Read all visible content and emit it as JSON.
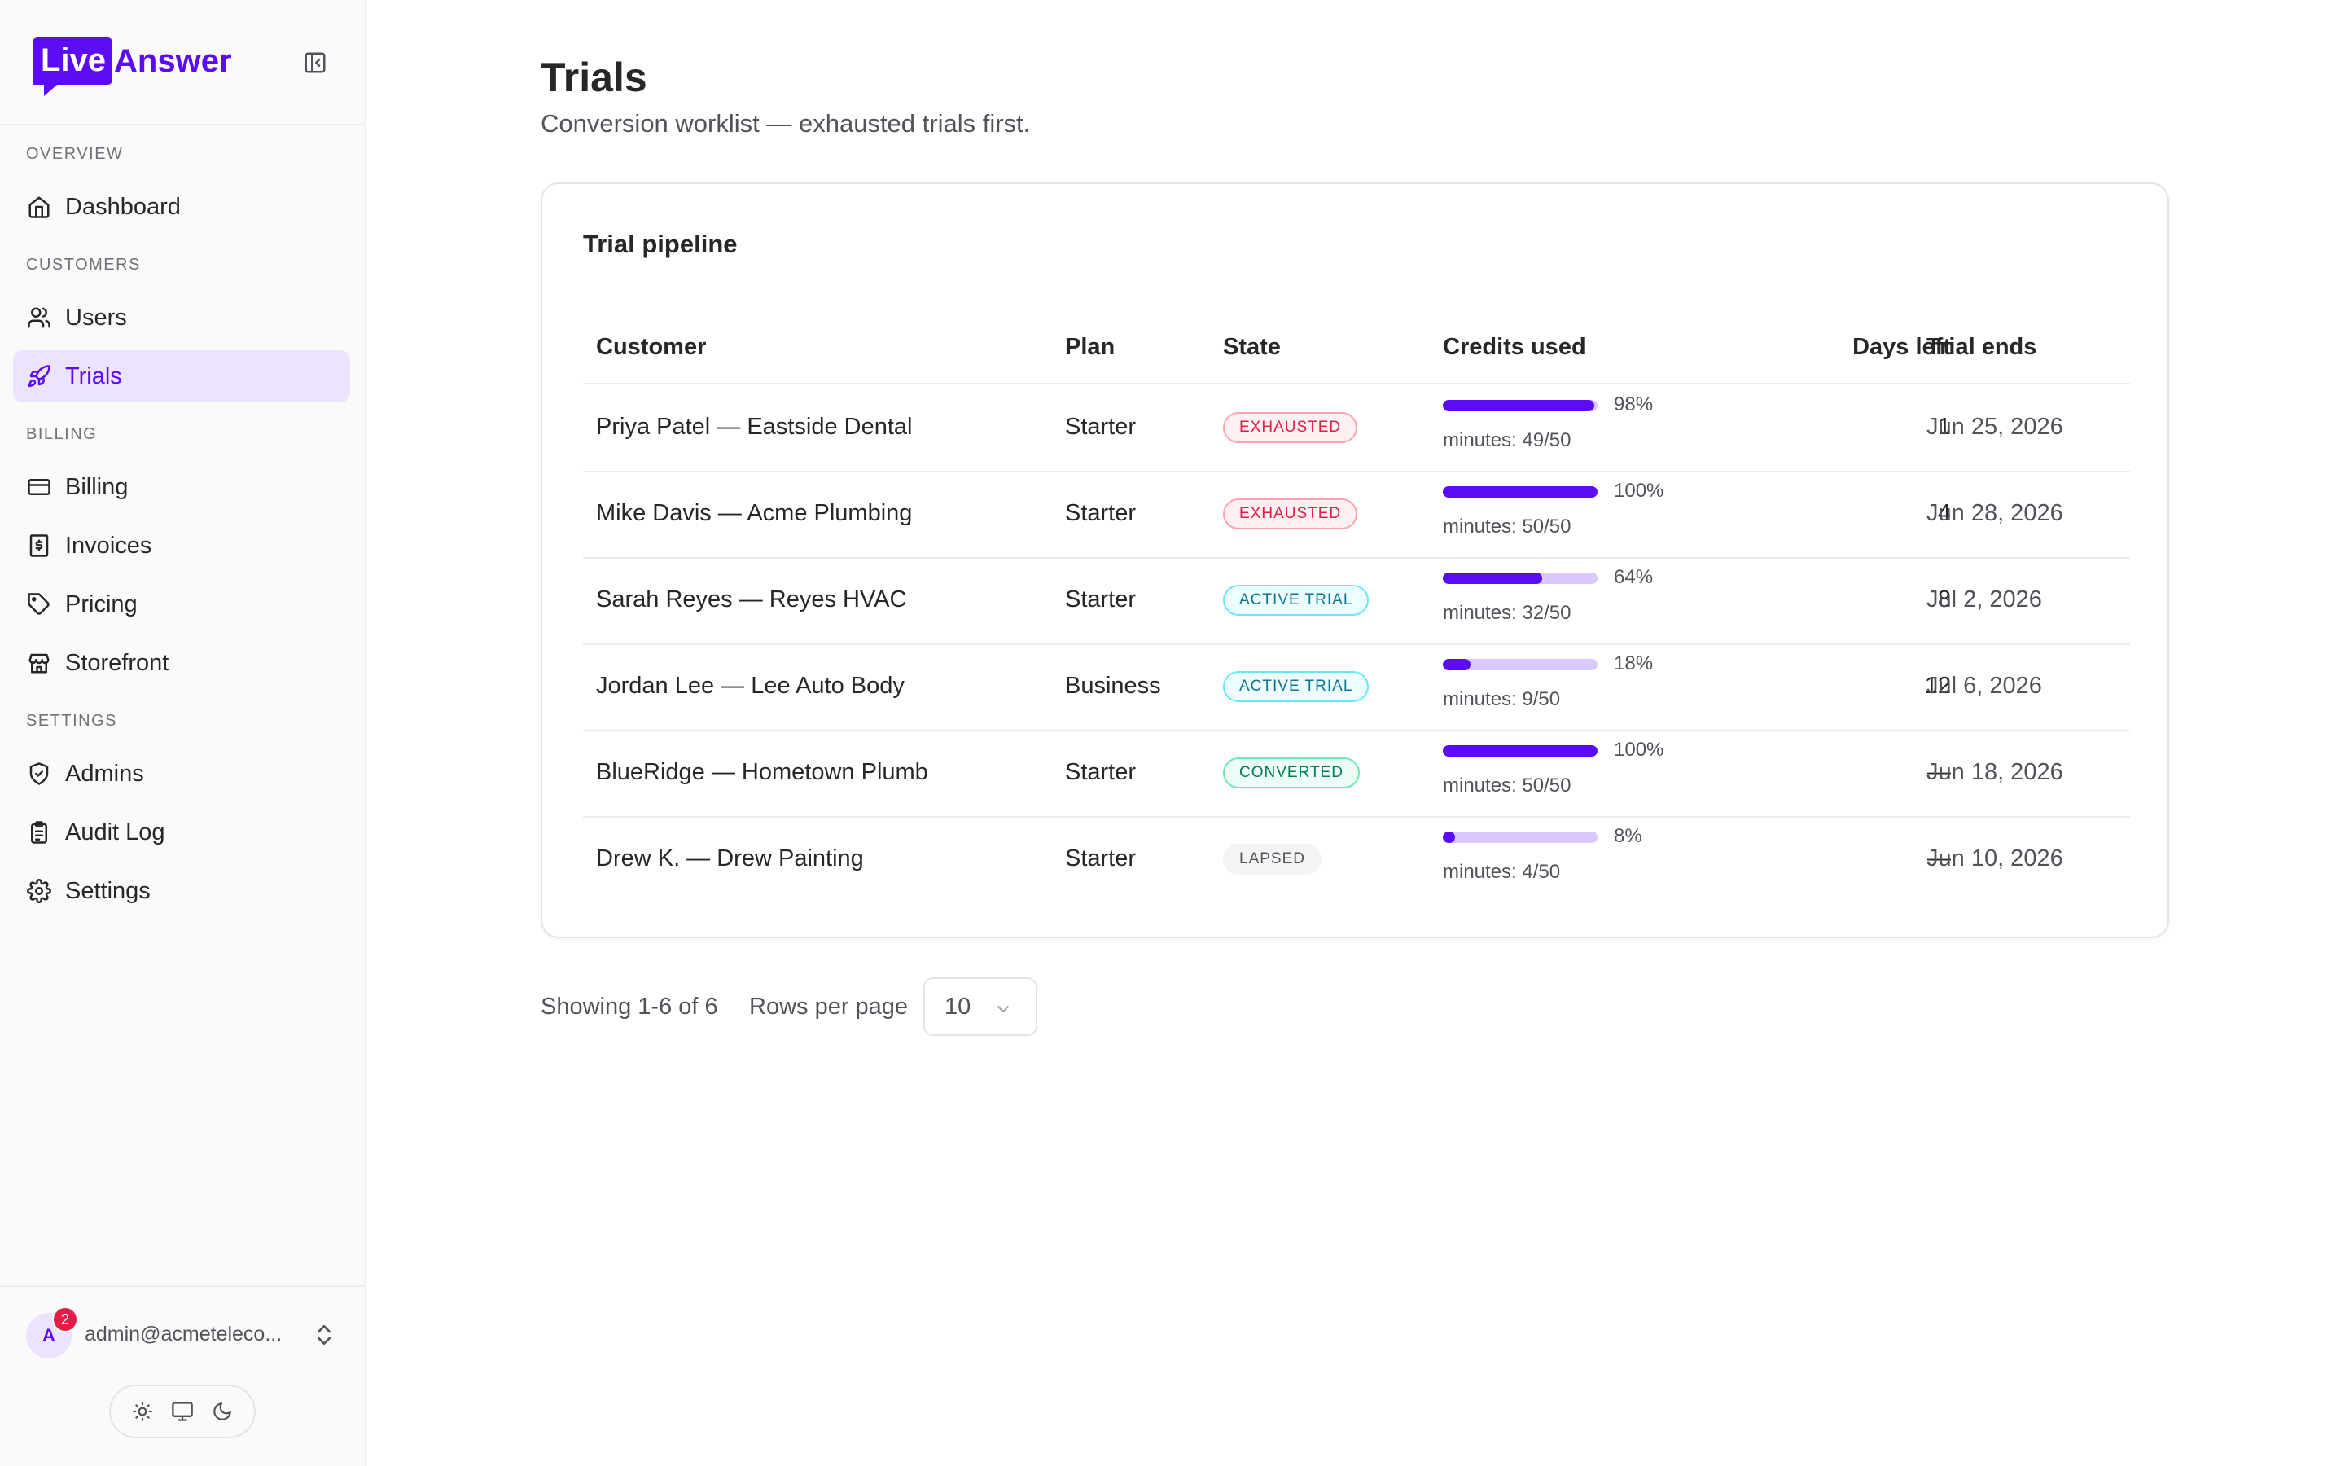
{
  "brand": {
    "logo_box": "Live",
    "logo_word": "Answer",
    "accent": "#5b0cf2"
  },
  "sidebar": {
    "sections": [
      {
        "label": "OVERVIEW"
      },
      {
        "label": "CUSTOMERS"
      },
      {
        "label": "BILLING"
      },
      {
        "label": "SETTINGS"
      }
    ],
    "items": [
      {
        "label": "Dashboard",
        "icon": "home-icon"
      },
      {
        "label": "Users",
        "icon": "users-icon"
      },
      {
        "label": "Trials",
        "icon": "rocket-icon",
        "active": true
      },
      {
        "label": "Billing",
        "icon": "credit-card-icon"
      },
      {
        "label": "Invoices",
        "icon": "receipt-icon"
      },
      {
        "label": "Pricing",
        "icon": "tag-icon"
      },
      {
        "label": "Storefront",
        "icon": "store-icon"
      },
      {
        "label": "Admins",
        "icon": "shield-icon"
      },
      {
        "label": "Audit Log",
        "icon": "clipboard-icon"
      },
      {
        "label": "Settings",
        "icon": "gear-icon"
      }
    ],
    "user": {
      "avatar_letter": "A",
      "notifications": "2",
      "email": "admin@acmeteleco..."
    }
  },
  "page": {
    "title": "Trials",
    "subtitle": "Conversion worklist — exhausted trials first."
  },
  "card": {
    "title": "Trial pipeline",
    "columns": [
      "Customer",
      "Plan",
      "State",
      "Credits used",
      "Days left",
      "Trial ends"
    ],
    "rows": [
      {
        "customer": "Priya Patel — Eastside Dental",
        "plan": "Starter",
        "state": "EXHAUSTED",
        "state_kind": "exhausted",
        "credits_pct": "98%",
        "credits_fraction": 0.98,
        "minutes": "minutes: 49/50",
        "days_left": "1",
        "trial_ends": "Jun 25, 2026"
      },
      {
        "customer": "Mike Davis — Acme Plumbing",
        "plan": "Starter",
        "state": "EXHAUSTED",
        "state_kind": "exhausted",
        "credits_pct": "100%",
        "credits_fraction": 1.0,
        "minutes": "minutes: 50/50",
        "days_left": "4",
        "trial_ends": "Jun 28, 2026"
      },
      {
        "customer": "Sarah Reyes — Reyes HVAC",
        "plan": "Starter",
        "state": "ACTIVE TRIAL",
        "state_kind": "active",
        "credits_pct": "64%",
        "credits_fraction": 0.64,
        "minutes": "minutes: 32/50",
        "days_left": "8",
        "trial_ends": "Jul 2, 2026"
      },
      {
        "customer": "Jordan Lee — Lee Auto Body",
        "plan": "Business",
        "state": "ACTIVE TRIAL",
        "state_kind": "active",
        "credits_pct": "18%",
        "credits_fraction": 0.18,
        "minutes": "minutes: 9/50",
        "days_left": "12",
        "trial_ends": "Jul 6, 2026"
      },
      {
        "customer": "BlueRidge — Hometown Plumb",
        "plan": "Starter",
        "state": "CONVERTED",
        "state_kind": "converted",
        "credits_pct": "100%",
        "credits_fraction": 1.0,
        "minutes": "minutes: 50/50",
        "days_left": "—",
        "trial_ends": "Jun 18, 2026"
      },
      {
        "customer": "Drew K. — Drew Painting",
        "plan": "Starter",
        "state": "LAPSED",
        "state_kind": "lapsed",
        "credits_pct": "8%",
        "credits_fraction": 0.08,
        "minutes": "minutes: 4/50",
        "days_left": "—",
        "trial_ends": "Jun 10, 2026"
      }
    ]
  },
  "pagination": {
    "showing": "Showing 1-6 of 6",
    "rows_per_page_label": "Rows per page",
    "rows_per_page_value": "10"
  }
}
